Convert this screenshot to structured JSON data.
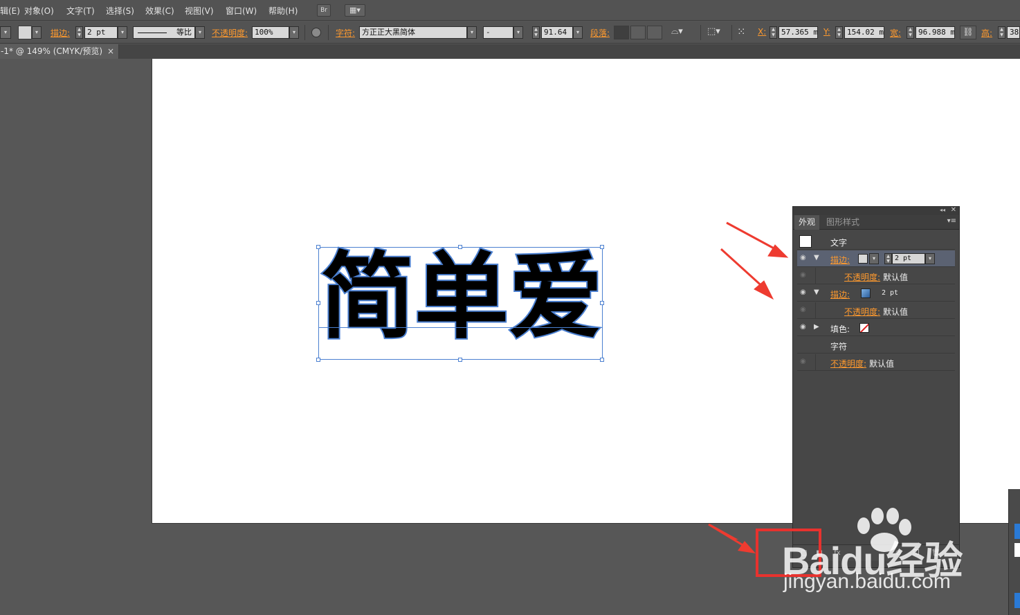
{
  "menubar": {
    "items": [
      "辑(E)",
      "对象(O)",
      "文字(T)",
      "选择(S)",
      "效果(C)",
      "视图(V)",
      "窗口(W)",
      "帮助(H)"
    ],
    "bridge_label": "Br"
  },
  "controlbar": {
    "stroke_label": "描边:",
    "stroke_value": "2 pt",
    "stroke_profile": "等比",
    "opacity_label": "不透明度:",
    "opacity_value": "100%",
    "char_label": "字符:",
    "font_family": "方正正大黑简体",
    "font_style": "-",
    "font_size": "91.64",
    "para_label": "段落:",
    "x_label": "X:",
    "x_value": "57.365 m",
    "y_label": "Y:",
    "y_value": "154.02 m",
    "w_label": "宽:",
    "w_value": "96.988 m",
    "h_label": "高:",
    "h_value": "38."
  },
  "document": {
    "tab_title": "-1* @ 149% (CMYK/预览)",
    "close_glyph": "×",
    "artwork_text": "简单爱"
  },
  "appearance_panel": {
    "tabs": [
      "外观",
      "图形样式"
    ],
    "header": "文字",
    "rows": [
      {
        "label": "描边:",
        "value": "2 pt",
        "highlight": true
      },
      {
        "label": "不透明度:",
        "value": "默认值"
      },
      {
        "label": "描边:",
        "value": "2 pt"
      },
      {
        "label": "不透明度:",
        "value": "默认值"
      },
      {
        "label": "填色:"
      },
      {
        "label": "字符"
      },
      {
        "label": "不透明度:",
        "value": "默认值"
      }
    ]
  },
  "colors": {
    "accent_orange": "#ff9a2e",
    "selection_blue": "#4a7fd0",
    "annotation_red": "#e8322e",
    "panel_bg": "#474747"
  },
  "watermark": {
    "brand": "Baidu经验",
    "url": "jingyan.baidu.com"
  }
}
